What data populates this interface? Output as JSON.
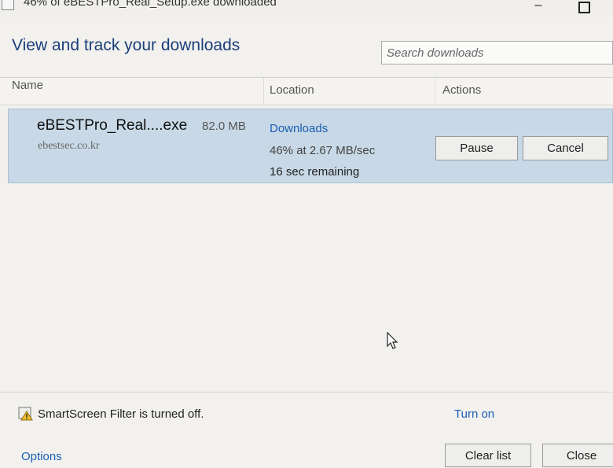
{
  "window": {
    "title": "46% of eBESTPro_Real_Setup.exe downloaded",
    "minimize_glyph": "–"
  },
  "header": {
    "heading": "View and track your downloads"
  },
  "search": {
    "placeholder": "Search downloads"
  },
  "columns": {
    "name": "Name",
    "location": "Location",
    "actions": "Actions"
  },
  "download": {
    "filename": "eBESTPro_Real....exe",
    "size": "82.0 MB",
    "source": "ebestsec.co.kr",
    "location": "Downloads",
    "progress": "46% at 2.67 MB/sec",
    "remaining": "16 sec remaining",
    "progress_percent": 46,
    "pause_label": "Pause",
    "cancel_label": "Cancel"
  },
  "smartscreen": {
    "text": "SmartScreen Filter is turned off.",
    "action": "Turn on",
    "icon": "warning-shield-icon"
  },
  "footer": {
    "options": "Options",
    "clear_list": "Clear list",
    "close": "Close"
  },
  "colors": {
    "accent": "#1a5fb4",
    "heading": "#1c3f7a",
    "selected_row": "#c8d8e6"
  }
}
